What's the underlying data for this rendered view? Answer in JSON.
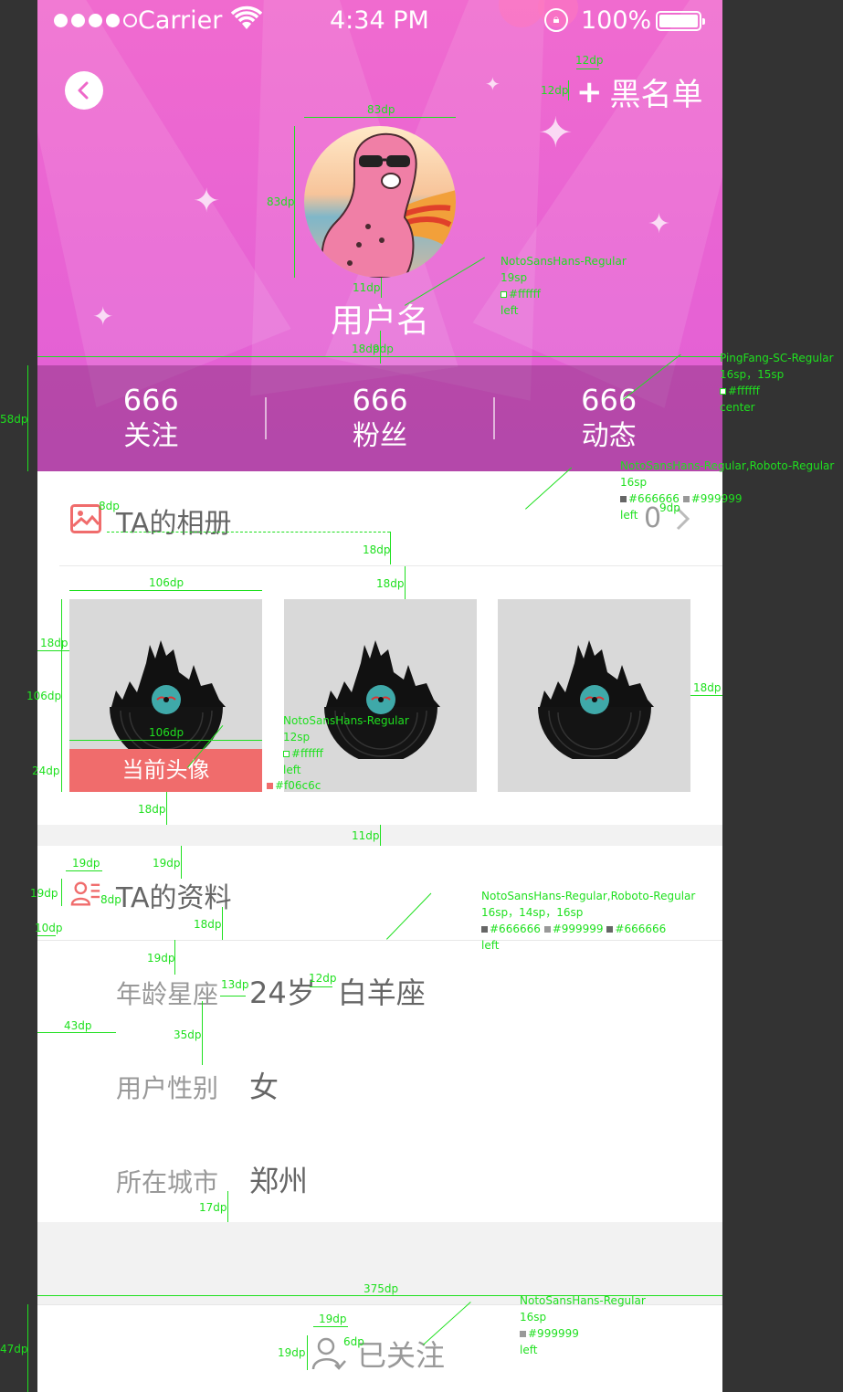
{
  "status_bar": {
    "carrier": "Carrier",
    "time": "4:34 PM",
    "battery": "100%",
    "signal_icon": "signal-dots-icon",
    "wifi_icon": "wifi-icon",
    "lock_icon": "rotation-lock-icon",
    "battery_icon": "battery-icon"
  },
  "header": {
    "back_icon": "chevron-left-icon",
    "blacklist_label": "黑名单",
    "blacklist_icon": "plus-icon",
    "username": "用户名",
    "gradient_from": "#f06bcf",
    "gradient_to": "#e05fd6"
  },
  "stats": [
    {
      "value": "666",
      "label": "关注"
    },
    {
      "value": "666",
      "label": "粉丝"
    },
    {
      "value": "666",
      "label": "动态"
    }
  ],
  "album": {
    "icon": "picture-icon",
    "title": "TA的相册",
    "count": "0",
    "chevron": "chevron-right-icon",
    "current_avatar_label": "当前头像",
    "current_avatar_color": "#f06c6c",
    "photo_icon": "vinyl-record-icon"
  },
  "profile": {
    "icon": "id-card-icon",
    "title": "TA的资料",
    "rows": [
      {
        "key": "年龄星座",
        "value": "24岁",
        "value2": "白羊座"
      },
      {
        "key": "用户性别",
        "value": "女",
        "value2": ""
      },
      {
        "key": "所在城市",
        "value": "郑州",
        "value2": ""
      }
    ]
  },
  "footer": {
    "icon": "user-check-icon",
    "label": "已关注"
  },
  "colors": {
    "text_dark": "#666666",
    "text_light": "#999999",
    "white": "#ffffff",
    "accent_red": "#f06c6c"
  },
  "annotations": {
    "blacklist_w": "12dp",
    "blacklist_h": "12dp",
    "avatar_w": "83dp",
    "avatar_h": "83dp",
    "avatar_gap": "11dp",
    "username_font": "NotoSansHans-Regular",
    "username_size": "19sp",
    "username_color": "#ffffff",
    "username_align": "left",
    "header_gap": "18dp",
    "header_gap2": "9dp",
    "stats_font": "PingFang-SC-Regular",
    "stats_size": "16sp，15sp",
    "stats_color": "#ffffff",
    "stats_align": "center",
    "stats_h": "58dp",
    "album_font": "NotoSansHans-Regular,Roboto-Regular",
    "album_size": "16sp",
    "album_color1": "#666666",
    "album_color2": "#999999",
    "album_align": "left",
    "album_icon_gap": "8dp",
    "album_count_gap": "9dp",
    "album_gap1": "18dp",
    "album_gap2": "18dp",
    "photo_w": "106dp",
    "photo_h": "106dp",
    "photo_left": "18dp",
    "photo_right": "18dp",
    "photo_inner_w": "106dp",
    "photo_cur_h": "24dp",
    "photo_bottom": "18dp",
    "cur_font": "NotoSansHans-Regular",
    "cur_size": "12sp",
    "cur_color": "#ffffff",
    "cur_align": "left",
    "cur_bg": "#f06c6c",
    "band_gap": "11dp",
    "info_icon_w": "19dp",
    "info_icon_top": "19dp",
    "info_icon_h": "19dp",
    "info_icon_gap": "8dp",
    "info_left": "10dp",
    "info_head_gap": "18dp",
    "info_font": "NotoSansHans-Regular,Roboto-Regular",
    "info_size": "16sp，14sp，16sp",
    "info_color1": "#666666",
    "info_color2": "#999999",
    "info_color3": "#666666",
    "info_align": "left",
    "row_top": "19dp",
    "row_kv_gap": "13dp",
    "row_vv_gap": "12dp",
    "row_left": "43dp",
    "row_gap": "35dp",
    "row_bottom": "17dp",
    "screen_w": "375dp",
    "footer_h": "47dp",
    "footer_icon_w": "19dp",
    "footer_icon_gap": "6dp",
    "footer_icon_h": "19dp",
    "footer_font": "NotoSansHans-Regular",
    "footer_size": "16sp",
    "footer_color": "#999999",
    "footer_align": "left"
  }
}
